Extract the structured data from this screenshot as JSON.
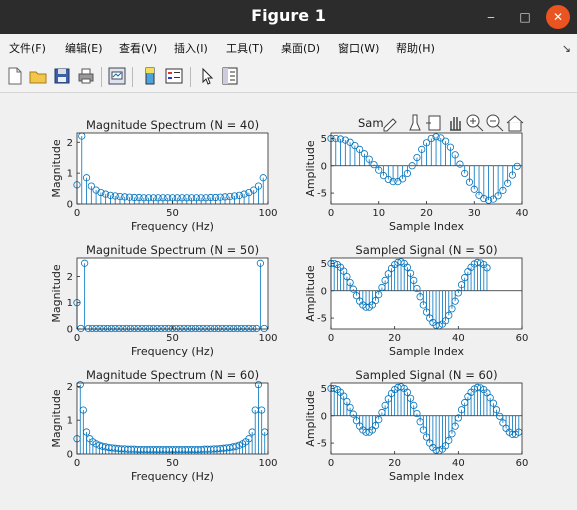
{
  "window": {
    "title": "Figure 1"
  },
  "window_controls": {
    "minimize": "‒",
    "maximize": "□",
    "close": "✕"
  },
  "menu": {
    "items": [
      "文件(F)",
      "编辑(E)",
      "查看(V)",
      "插入(I)",
      "工具(T)",
      "桌面(D)",
      "窗口(W)",
      "帮助(H)"
    ],
    "more": "↘"
  },
  "toolbar": {
    "buttons": [
      "new-figure-icon",
      "open-file-icon",
      "save-icon",
      "print-icon",
      "link-plot-icon",
      "insert-colorbar-icon",
      "insert-legend-icon",
      "edit-plot-arrow-icon",
      "property-inspector-icon"
    ]
  },
  "axes_toolbar": {
    "visible_title_fragment": "Sam",
    "buttons": [
      "export-icon",
      "brush-icon",
      "datatip-icon",
      "pan-icon",
      "zoom-in-icon",
      "zoom-out-icon",
      "home-icon"
    ]
  },
  "colors": {
    "stem": "#0072bd",
    "axes_bg": "#ffffff",
    "figure_bg": "#f0f0f0"
  },
  "chart_data": [
    {
      "type": "stem",
      "title": "Magnitude Spectrum (N = 40)",
      "xlabel": "Frequency (Hz)",
      "ylabel": "Magnitude",
      "xlim": [
        0,
        100
      ],
      "ylim": [
        0,
        2.3
      ],
      "xticks": [
        0,
        50,
        100
      ],
      "yticks": [
        0,
        1,
        2
      ],
      "x": [
        0,
        2.5,
        5,
        7.5,
        10,
        12.5,
        15,
        17.5,
        20,
        22.5,
        25,
        27.5,
        30,
        32.5,
        35,
        37.5,
        40,
        42.5,
        45,
        47.5,
        50,
        52.5,
        55,
        57.5,
        60,
        62.5,
        65,
        67.5,
        70,
        72.5,
        75,
        77.5,
        80,
        82.5,
        85,
        87.5,
        90,
        92.5,
        95,
        97.5
      ],
      "y": [
        0.62,
        2.2,
        0.85,
        0.58,
        0.45,
        0.37,
        0.32,
        0.28,
        0.26,
        0.24,
        0.23,
        0.22,
        0.21,
        0.21,
        0.2,
        0.2,
        0.2,
        0.2,
        0.2,
        0.2,
        0.2,
        0.2,
        0.2,
        0.2,
        0.2,
        0.2,
        0.2,
        0.2,
        0.21,
        0.21,
        0.22,
        0.23,
        0.24,
        0.26,
        0.28,
        0.32,
        0.37,
        0.45,
        0.58,
        0.85
      ]
    },
    {
      "type": "stem",
      "title": "",
      "xlabel": "Sample Index",
      "ylabel": "Amplitude",
      "xlim": [
        0,
        40
      ],
      "ylim": [
        -7,
        6
      ],
      "xticks": [
        0,
        10,
        20,
        30,
        40
      ],
      "yticks": [
        -5,
        0,
        5
      ],
      "x": [
        0,
        1,
        2,
        3,
        4,
        5,
        6,
        7,
        8,
        9,
        10,
        11,
        12,
        13,
        14,
        15,
        16,
        17,
        18,
        19,
        20,
        21,
        22,
        23,
        24,
        25,
        26,
        27,
        28,
        29,
        30,
        31,
        32,
        33,
        34,
        35,
        36,
        37,
        38,
        39
      ],
      "y": [
        5.0,
        5.0,
        4.9,
        4.7,
        4.3,
        3.7,
        3.0,
        2.2,
        1.2,
        0.2,
        -0.8,
        -1.8,
        -2.5,
        -2.9,
        -2.9,
        -2.4,
        -1.4,
        0.0,
        1.5,
        3.0,
        4.2,
        5.0,
        5.3,
        5.1,
        4.5,
        3.4,
        2.0,
        0.3,
        -1.4,
        -3.0,
        -4.3,
        -5.4,
        -6.0,
        -6.3,
        -6.1,
        -5.5,
        -4.5,
        -3.2,
        -1.7,
        -0.1
      ]
    },
    {
      "type": "stem",
      "title": "Magnitude Spectrum (N = 50)",
      "xlabel": "Frequency (Hz)",
      "ylabel": "Magnitude",
      "xlim": [
        0,
        100
      ],
      "ylim": [
        0,
        2.7
      ],
      "xticks": [
        0,
        50,
        100
      ],
      "yticks": [
        0,
        1,
        2
      ],
      "x": [
        0,
        2,
        4,
        6,
        8,
        10,
        12,
        14,
        16,
        18,
        20,
        22,
        24,
        26,
        28,
        30,
        32,
        34,
        36,
        38,
        40,
        42,
        44,
        46,
        48,
        50,
        52,
        54,
        56,
        58,
        60,
        62,
        64,
        66,
        68,
        70,
        72,
        74,
        76,
        78,
        80,
        82,
        84,
        86,
        88,
        90,
        92,
        94,
        96,
        98
      ],
      "y": [
        1.0,
        0.02,
        2.5,
        0.02,
        0.02,
        0.02,
        0.02,
        0.02,
        0.02,
        0.02,
        0.02,
        0.02,
        0.02,
        0.02,
        0.02,
        0.02,
        0.02,
        0.02,
        0.02,
        0.02,
        0.02,
        0.02,
        0.02,
        0.02,
        0.02,
        0.02,
        0.02,
        0.02,
        0.02,
        0.02,
        0.02,
        0.02,
        0.02,
        0.02,
        0.02,
        0.02,
        0.02,
        0.02,
        0.02,
        0.02,
        0.02,
        0.02,
        0.02,
        0.02,
        0.02,
        0.02,
        0.02,
        0.02,
        2.5,
        0.02
      ]
    },
    {
      "type": "stem",
      "title": "Sampled Signal (N = 50)",
      "xlabel": "Sample Index",
      "ylabel": "Amplitude",
      "xlim": [
        0,
        60
      ],
      "ylim": [
        -7,
        6
      ],
      "xticks": [
        0,
        20,
        40,
        60
      ],
      "yticks": [
        -5,
        0,
        5
      ],
      "x": [
        0,
        1,
        2,
        3,
        4,
        5,
        6,
        7,
        8,
        9,
        10,
        11,
        12,
        13,
        14,
        15,
        16,
        17,
        18,
        19,
        20,
        21,
        22,
        23,
        24,
        25,
        26,
        27,
        28,
        29,
        30,
        31,
        32,
        33,
        34,
        35,
        36,
        37,
        38,
        39,
        40,
        41,
        42,
        43,
        44,
        45,
        46,
        47,
        48,
        49
      ],
      "y": [
        5.0,
        5.0,
        4.8,
        4.3,
        3.6,
        2.6,
        1.5,
        0.3,
        -0.9,
        -1.9,
        -2.6,
        -3.0,
        -3.0,
        -2.6,
        -1.8,
        -0.7,
        0.6,
        1.9,
        3.1,
        4.1,
        4.8,
        5.2,
        5.3,
        5.0,
        4.3,
        3.2,
        1.9,
        0.4,
        -1.1,
        -2.6,
        -3.9,
        -5.0,
        -5.8,
        -6.3,
        -6.4,
        -6.1,
        -5.5,
        -4.5,
        -3.3,
        -1.9,
        -0.4,
        1.1,
        2.4,
        3.5,
        4.3,
        4.9,
        5.2,
        5.1,
        4.8,
        4.2
      ]
    },
    {
      "type": "stem",
      "title": "Magnitude Spectrum (N = 60)",
      "xlabel": "Frequency (Hz)",
      "ylabel": "Magnitude",
      "xlim": [
        0,
        100
      ],
      "ylim": [
        0,
        2.1
      ],
      "xticks": [
        0,
        50,
        100
      ],
      "yticks": [
        0,
        1,
        2
      ],
      "x": [
        0,
        1.7,
        3.3,
        5,
        6.7,
        8.3,
        10,
        11.7,
        13.3,
        15,
        16.7,
        18.3,
        20,
        21.7,
        23.3,
        25,
        26.7,
        28.3,
        30,
        31.7,
        33.3,
        35,
        36.7,
        38.3,
        40,
        41.7,
        43.3,
        45,
        46.7,
        48.3,
        50,
        51.7,
        53.3,
        55,
        56.7,
        58.3,
        60,
        61.7,
        63.3,
        65,
        66.7,
        68.3,
        70,
        71.7,
        73.3,
        75,
        76.7,
        78.3,
        80,
        81.7,
        83.3,
        85,
        86.7,
        88.3,
        90,
        91.7,
        93.3,
        95,
        96.7,
        98.3
      ],
      "y": [
        0.45,
        2.05,
        1.3,
        0.65,
        0.45,
        0.36,
        0.3,
        0.26,
        0.23,
        0.21,
        0.19,
        0.18,
        0.17,
        0.16,
        0.15,
        0.15,
        0.14,
        0.14,
        0.14,
        0.13,
        0.13,
        0.13,
        0.13,
        0.13,
        0.13,
        0.13,
        0.13,
        0.13,
        0.13,
        0.13,
        0.13,
        0.13,
        0.13,
        0.13,
        0.13,
        0.13,
        0.13,
        0.13,
        0.13,
        0.13,
        0.14,
        0.14,
        0.14,
        0.15,
        0.15,
        0.16,
        0.17,
        0.18,
        0.19,
        0.21,
        0.23,
        0.26,
        0.3,
        0.36,
        0.45,
        0.65,
        1.3,
        2.05,
        1.3,
        0.65
      ]
    },
    {
      "type": "stem",
      "title": "Sampled Signal (N = 60)",
      "xlabel": "Sample Index",
      "ylabel": "Amplitude",
      "xlim": [
        0,
        60
      ],
      "ylim": [
        -7,
        6
      ],
      "xticks": [
        0,
        20,
        40,
        60
      ],
      "yticks": [
        -5,
        0,
        5
      ],
      "x": [
        0,
        1,
        2,
        3,
        4,
        5,
        6,
        7,
        8,
        9,
        10,
        11,
        12,
        13,
        14,
        15,
        16,
        17,
        18,
        19,
        20,
        21,
        22,
        23,
        24,
        25,
        26,
        27,
        28,
        29,
        30,
        31,
        32,
        33,
        34,
        35,
        36,
        37,
        38,
        39,
        40,
        41,
        42,
        43,
        44,
        45,
        46,
        47,
        48,
        49,
        50,
        51,
        52,
        53,
        54,
        55,
        56,
        57,
        58,
        59
      ],
      "y": [
        5.0,
        5.0,
        4.8,
        4.3,
        3.6,
        2.6,
        1.5,
        0.3,
        -0.9,
        -1.9,
        -2.6,
        -3.0,
        -3.0,
        -2.6,
        -1.8,
        -0.7,
        0.6,
        1.9,
        3.1,
        4.1,
        4.8,
        5.2,
        5.3,
        5.0,
        4.3,
        3.2,
        1.9,
        0.4,
        -1.1,
        -2.6,
        -3.9,
        -5.0,
        -5.8,
        -6.3,
        -6.4,
        -6.1,
        -5.5,
        -4.5,
        -3.3,
        -1.9,
        -0.4,
        1.1,
        2.4,
        3.5,
        4.3,
        4.9,
        5.2,
        5.1,
        4.8,
        4.2,
        3.3,
        2.3,
        1.1,
        -0.1,
        -1.3,
        -2.3,
        -3.0,
        -3.4,
        -3.4,
        -3.0
      ]
    }
  ]
}
